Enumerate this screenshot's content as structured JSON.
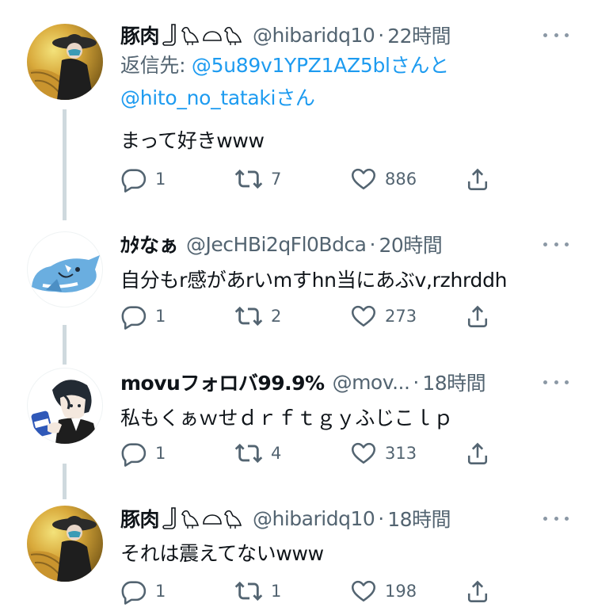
{
  "colors": {
    "text": "#0f1419",
    "secondary": "#536471",
    "mention": "#1d9bf0",
    "thread_line": "#cfd9de"
  },
  "tweets": [
    {
      "name": "豚肉",
      "decoration_icons": [
        "boot-icon",
        "bird-icon",
        "bread-icon",
        "bird-icon"
      ],
      "handle": "@hibaridq10",
      "separator": "·",
      "time": "22時間",
      "reply_to": {
        "prefix": "返信先:",
        "mention1": "@5u89v1YPZ1AZ5bl",
        "suffix1": "さんと",
        "mention2": "@hito_no_tataki",
        "suffix2": "さん"
      },
      "text": "まって好きwww",
      "replies": "1",
      "retweets": "7",
      "likes": "886"
    },
    {
      "name": "ｶﾀなぁ",
      "handle": "@JecHBi2qFl0Bdca",
      "separator": "·",
      "time": "20時間",
      "text": "自分もr感があrいmすhn当にあぶv,rzhrddh",
      "replies": "1",
      "retweets": "2",
      "likes": "273"
    },
    {
      "name": "movuフォロバ99.9%",
      "handle": "@mov...",
      "separator": "·",
      "time": "18時間",
      "text": "私もくぁｗせｄｒｆｔｇｙふじこｌｐ",
      "replies": "1",
      "retweets": "4",
      "likes": "313"
    },
    {
      "name": "豚肉",
      "decoration_icons": [
        "boot-icon",
        "bird-icon",
        "bread-icon",
        "bird-icon"
      ],
      "handle": "@hibaridq10",
      "separator": "·",
      "time": "18時間",
      "text": "それは震えてないwww",
      "replies": "1",
      "retweets": "1",
      "likes": "198"
    }
  ]
}
